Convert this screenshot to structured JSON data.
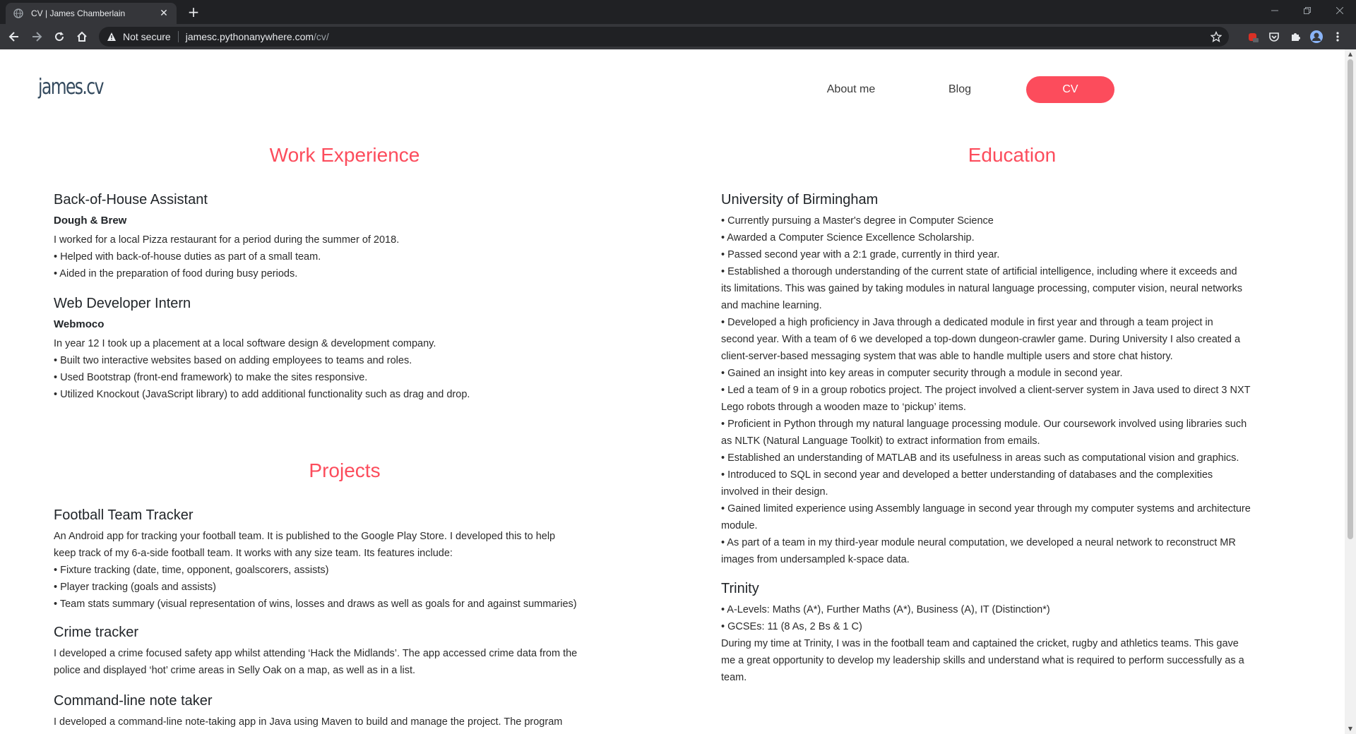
{
  "browser": {
    "tab_title": "CV | James Chamberlain",
    "security_label": "Not secure",
    "url_host": "jamesc.pythonanywhere.com",
    "url_path": "/cv/",
    "accent": "#fc4c5c"
  },
  "site": {
    "brand": "james.cv",
    "nav": [
      {
        "label": "About me"
      },
      {
        "label": "Blog"
      },
      {
        "label": "CV"
      }
    ]
  },
  "work": {
    "title": "Work Experience",
    "entries": [
      {
        "title": "Back-of-House Assistant",
        "company": "Dough & Brew",
        "lines": [
          "I worked for a local Pizza restaurant for a period during the summer of 2018.",
          "• Helped with back-of-house duties as part of a small team.",
          "• Aided in the preparation of food during busy periods."
        ]
      },
      {
        "title": "Web Developer Intern",
        "company": "Webmoco",
        "lines": [
          "In year 12 I took up a placement at a local software design & development company.",
          "• Built two interactive websites based on adding employees to teams and roles.",
          "• Used Bootstrap (front-end framework) to make the sites responsive.",
          "• Utilized Knockout (JavaScript library) to add additional functionality such as drag and drop."
        ]
      }
    ]
  },
  "projects": {
    "title": "Projects",
    "entries": [
      {
        "title": "Football Team Tracker",
        "lines": [
          "An Android app for tracking your football team. It is published to the Google Play Store. I developed this to help",
          "keep track of my 6-a-side football team. It works with any size team. Its features include:",
          "• Fixture tracking (date, time, opponent, goalscorers, assists)",
          "• Player tracking (goals and assists)",
          "• Team stats summary (visual representation of wins, losses and draws as well as goals for and against summaries)"
        ]
      },
      {
        "title": "Crime tracker",
        "lines": [
          "I developed a crime focused safety app whilst attending ‘Hack the Midlands’. The app accessed crime data from the",
          "police and displayed ‘hot’ crime areas in Selly Oak on a map, as well as in a list."
        ]
      },
      {
        "title": "Command-line note taker",
        "lines": [
          "I developed a command-line note-taking app in Java using Maven to build and manage the project. The program"
        ]
      }
    ]
  },
  "education": {
    "title": "Education",
    "entries": [
      {
        "title": "University of Birmingham",
        "lines": [
          "• Currently pursuing a Master's degree in Computer Science",
          "• Awarded a Computer Science Excellence Scholarship.",
          "• Passed second year with a 2:1 grade, currently in third year.",
          "• Established a thorough understanding of the current state of artificial intelligence, including where it exceeds and",
          "its limitations. This was gained by taking modules in natural language processing, computer vision, neural networks",
          "and machine learning.",
          "• Developed a high proficiency in Java through a dedicated module in first year and through a team project in",
          "second year. With a team of 6 we developed a top-down dungeon-crawler game. During University I also created a",
          "client-server-based messaging system that was able to handle multiple users and store chat history.",
          "• Gained an insight into key areas in computer security through a module in second year.",
          "• Led a team of 9 in a group robotics project. The project involved a client-server system in Java used to direct 3 NXT",
          "Lego robots through a wooden maze to ‘pickup’ items.",
          "• Proficient in Python through my natural language processing module. Our coursework involved using libraries such",
          "as NLTK (Natural Language Toolkit) to extract information from emails.",
          "• Established an understanding of MATLAB and its usefulness in areas such as computational vision and graphics.",
          "• Introduced to SQL in second year and developed a better understanding of databases and the complexities",
          "involved in their design.",
          "• Gained limited experience using Assembly language in second year through my computer systems and architecture",
          "module.",
          "• As part of a team in my third-year module neural computation, we developed a neural network to reconstruct MR",
          "images from undersampled k-space data."
        ]
      },
      {
        "title": "Trinity",
        "lines": [
          "• A-Levels: Maths (A*), Further Maths (A*), Business (A), IT (Distinction*)",
          "• GCSEs: 11 (8 As, 2 Bs & 1 C)",
          "During my time at Trinity, I was in the football team and captained the cricket, rugby and athletics teams. This gave",
          "me a great opportunity to develop my leadership skills and understand what is required to perform successfully as a",
          "team."
        ]
      }
    ]
  }
}
